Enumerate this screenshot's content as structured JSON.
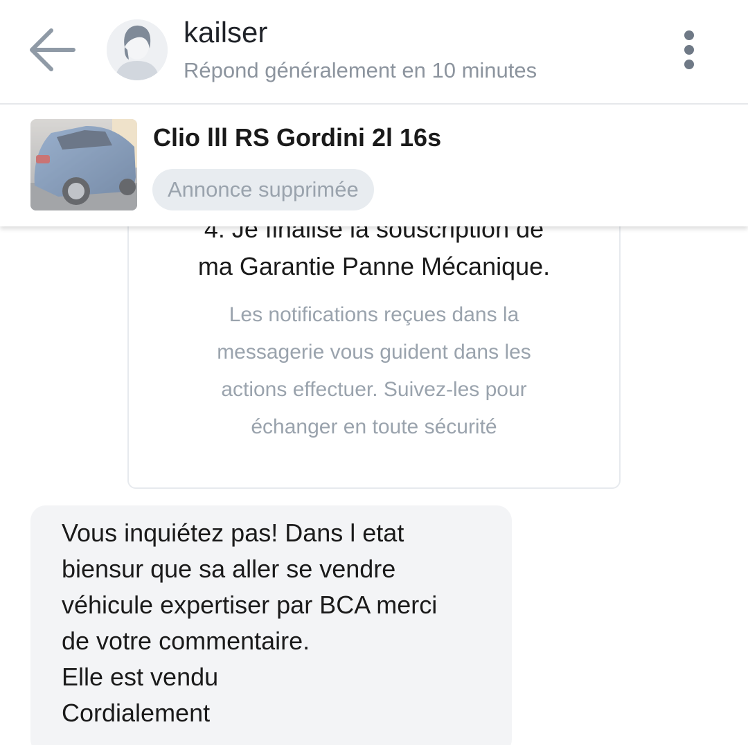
{
  "header": {
    "contact_name": "kailser",
    "contact_status": "Répond généralement en 10 minutes",
    "back_icon": "arrow-left-icon",
    "menu_icon": "more-vertical-icon"
  },
  "listing": {
    "title": "Clio lll RS Gordini 2l 16s",
    "status_badge": "Annonce supprimée"
  },
  "system_card": {
    "step_lines": [
      "4. Je finalise la souscription de",
      "ma Garantie Panne Mécanique."
    ],
    "hint_lines": [
      "Les notifications reçues dans la",
      "messagerie vous guident dans les",
      "actions effectuer. Suivez-les pour",
      "échanger en toute sécurité"
    ]
  },
  "messages": [
    {
      "direction": "incoming",
      "lines": [
        "Vous inquiétez pas! Dans l etat",
        "biensur que sa aller se vendre",
        "véhicule expertiser par BCA merci",
        "de votre commentaire.",
        "Elle est vendu",
        "Cordialement"
      ]
    }
  ],
  "colors": {
    "bubble_background": "#f3f4f6",
    "muted_text": "#9aa3ad",
    "icon_gray": "#6f7986"
  }
}
